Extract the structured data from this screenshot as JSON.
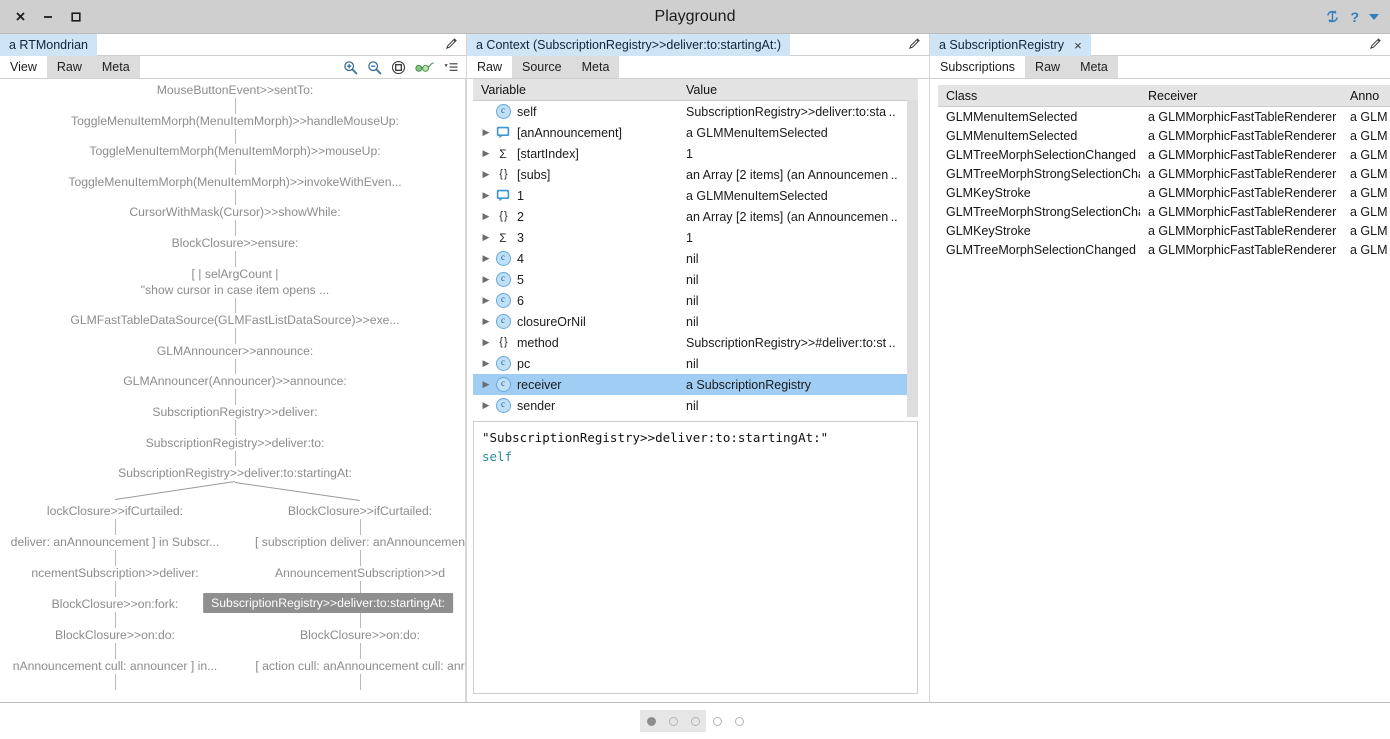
{
  "window": {
    "title": "Playground",
    "controls": {
      "close": "×",
      "minimize": "−",
      "maximize": "□"
    },
    "right_icons": {
      "sync": "sync-icon",
      "help": "?",
      "menu": "▾"
    }
  },
  "panes": [
    {
      "header": {
        "title": "a RTMondrian",
        "closable": false,
        "pencil": "pencil-icon"
      },
      "tabs": [
        {
          "label": "View",
          "active": true
        },
        {
          "label": "Raw",
          "active": false
        },
        {
          "label": "Meta",
          "active": false
        }
      ],
      "tools": [
        "zoom-in-icon",
        "zoom-out-icon",
        "fit-icon",
        "inspect-glasses-icon",
        "menu-list-icon"
      ],
      "tree": {
        "highlighted": "SubscriptionRegistry>>deliver:to:startingAt:",
        "trunk": [
          "MouseButtonEvent>>sentTo:",
          "ToggleMenuItemMorph(MenuItemMorph)>>handleMouseUp:",
          "ToggleMenuItemMorph(MenuItemMorph)>>mouseUp:",
          "ToggleMenuItemMorph(MenuItemMorph)>>invokeWithEven...",
          "CursorWithMask(Cursor)>>showWhile:",
          "BlockClosure>>ensure:",
          "[ | selArgCount |",
          "\"show cursor in case item opens ...",
          "GLMFastTableDataSource(GLMFastListDataSource)>>exe...",
          "GLMAnnouncer>>announce:",
          "GLMAnnouncer(Announcer)>>announce:",
          "SubscriptionRegistry>>deliver:",
          "SubscriptionRegistry>>deliver:to:",
          "SubscriptionRegistry>>deliver:to:startingAt:"
        ],
        "left_branch": [
          "lockClosure>>ifCurtailed:",
          "deliver: anAnnouncement ] in Subscr...",
          "ncementSubscription>>deliver:",
          "BlockClosure>>on:fork:",
          "BlockClosure>>on:do:",
          "nAnnouncement cull: announcer ] in..."
        ],
        "right_branch": [
          "BlockClosure>>ifCurtailed:",
          "[ subscription deliver: anAnnouncemen",
          "AnnouncementSubscription>>d",
          "BlockClosure>>on:fork:",
          "BlockClosure>>on:do:",
          "[ action cull: anAnnouncement cull: anr"
        ]
      }
    },
    {
      "header": {
        "title": "a Context (SubscriptionRegistry>>deliver:to:startingAt:)",
        "closable": false,
        "pencil": "pencil-icon"
      },
      "tabs": [
        {
          "label": "Raw",
          "active": true
        },
        {
          "label": "Source",
          "active": false
        },
        {
          "label": "Meta",
          "active": false
        }
      ],
      "table": {
        "columns": [
          "Variable",
          "Value"
        ],
        "rows": [
          {
            "arrow": false,
            "icon": "class-circle-icon",
            "icon_glyph": "c",
            "name": "self",
            "value": "SubscriptionRegistry>>deliver:to:sta ..",
            "selected": false
          },
          {
            "arrow": true,
            "icon": "announcement-bubble-icon",
            "icon_glyph": "▢",
            "name": "[anAnnouncement]",
            "value": "a GLMMenuItemSelected",
            "selected": false
          },
          {
            "arrow": true,
            "icon": "number-sigma-icon",
            "icon_glyph": "Σ",
            "name": "[startIndex]",
            "value": "1",
            "selected": false
          },
          {
            "arrow": true,
            "icon": "collection-braces-icon",
            "icon_glyph": "{ }",
            "name": "[subs]",
            "value": "an Array [2 items] (an Announcemen ..",
            "selected": false
          },
          {
            "arrow": true,
            "icon": "announcement-bubble-icon",
            "icon_glyph": "▢",
            "name": "1",
            "value": "a GLMMenuItemSelected",
            "selected": false
          },
          {
            "arrow": true,
            "icon": "collection-braces-icon",
            "icon_glyph": "{ }",
            "name": "2",
            "value": "an Array [2 items] (an Announcemen ..",
            "selected": false
          },
          {
            "arrow": true,
            "icon": "number-sigma-icon",
            "icon_glyph": "Σ",
            "name": "3",
            "value": "1",
            "selected": false
          },
          {
            "arrow": true,
            "icon": "class-circle-icon",
            "icon_glyph": "c",
            "name": "4",
            "value": "nil",
            "selected": false
          },
          {
            "arrow": true,
            "icon": "class-circle-icon",
            "icon_glyph": "c",
            "name": "5",
            "value": "nil",
            "selected": false
          },
          {
            "arrow": true,
            "icon": "class-circle-icon",
            "icon_glyph": "c",
            "name": "6",
            "value": "nil",
            "selected": false
          },
          {
            "arrow": true,
            "icon": "class-circle-icon",
            "icon_glyph": "c",
            "name": "closureOrNil",
            "value": "nil",
            "selected": false
          },
          {
            "arrow": true,
            "icon": "collection-braces-icon",
            "icon_glyph": "{ }",
            "name": "method",
            "value": "SubscriptionRegistry>>#deliver:to:st ..",
            "selected": false
          },
          {
            "arrow": true,
            "icon": "class-circle-icon",
            "icon_glyph": "c",
            "name": "pc",
            "value": "nil",
            "selected": false
          },
          {
            "arrow": true,
            "icon": "class-circle-icon",
            "icon_glyph": "c",
            "name": "receiver",
            "value": "a SubscriptionRegistry",
            "selected": true
          },
          {
            "arrow": true,
            "icon": "class-circle-icon",
            "icon_glyph": "c",
            "name": "sender",
            "value": "nil",
            "selected": false
          }
        ]
      },
      "editor": {
        "comment_line": "\"SubscriptionRegistry>>deliver:to:startingAt:\"",
        "code_line": "self"
      }
    },
    {
      "header": {
        "title": "a SubscriptionRegistry",
        "closable": true,
        "close_glyph": "×",
        "pencil": "pencil-icon"
      },
      "tabs": [
        {
          "label": "Subscriptions",
          "active": true
        },
        {
          "label": "Raw",
          "active": false
        },
        {
          "label": "Meta",
          "active": false
        }
      ],
      "table": {
        "columns": [
          "Class",
          "Receiver",
          "Anno"
        ],
        "rows": [
          [
            "GLMMenuItemSelected",
            "a GLMMorphicFastTableRenderer",
            "a GLM"
          ],
          [
            "GLMMenuItemSelected",
            "a GLMMorphicFastTableRenderer",
            "a GLM"
          ],
          [
            "GLMTreeMorphSelectionChanged",
            "a GLMMorphicFastTableRenderer",
            "a GLM"
          ],
          [
            "GLMTreeMorphStrongSelectionChar",
            "a GLMMorphicFastTableRenderer",
            "a GLM"
          ],
          [
            "GLMKeyStroke",
            "a GLMMorphicFastTableRenderer",
            "a GLM"
          ],
          [
            "GLMTreeMorphStrongSelectionChar",
            "a GLMMorphicFastTableRenderer",
            "a GLM"
          ],
          [
            "GLMKeyStroke",
            "a GLMMorphicFastTableRenderer",
            "a GLM"
          ],
          [
            "GLMTreeMorphSelectionChanged",
            "a GLMMorphicFastTableRenderer",
            "a GLM"
          ]
        ]
      }
    }
  ],
  "footer": {
    "pager": {
      "total": 5,
      "active_index": 0,
      "shaded_count": 3
    }
  },
  "colors": {
    "pane_title_bg": "#cfe4f5",
    "titlebar_bg": "#cfcfcf",
    "selection_blue": "#9fcdf4",
    "tab_inactive_bg": "#dcdcdc",
    "accent_blue": "#2f7fc1",
    "tree_text": "#8c8c8c",
    "tree_highlight_bg": "#8f8f8f"
  }
}
